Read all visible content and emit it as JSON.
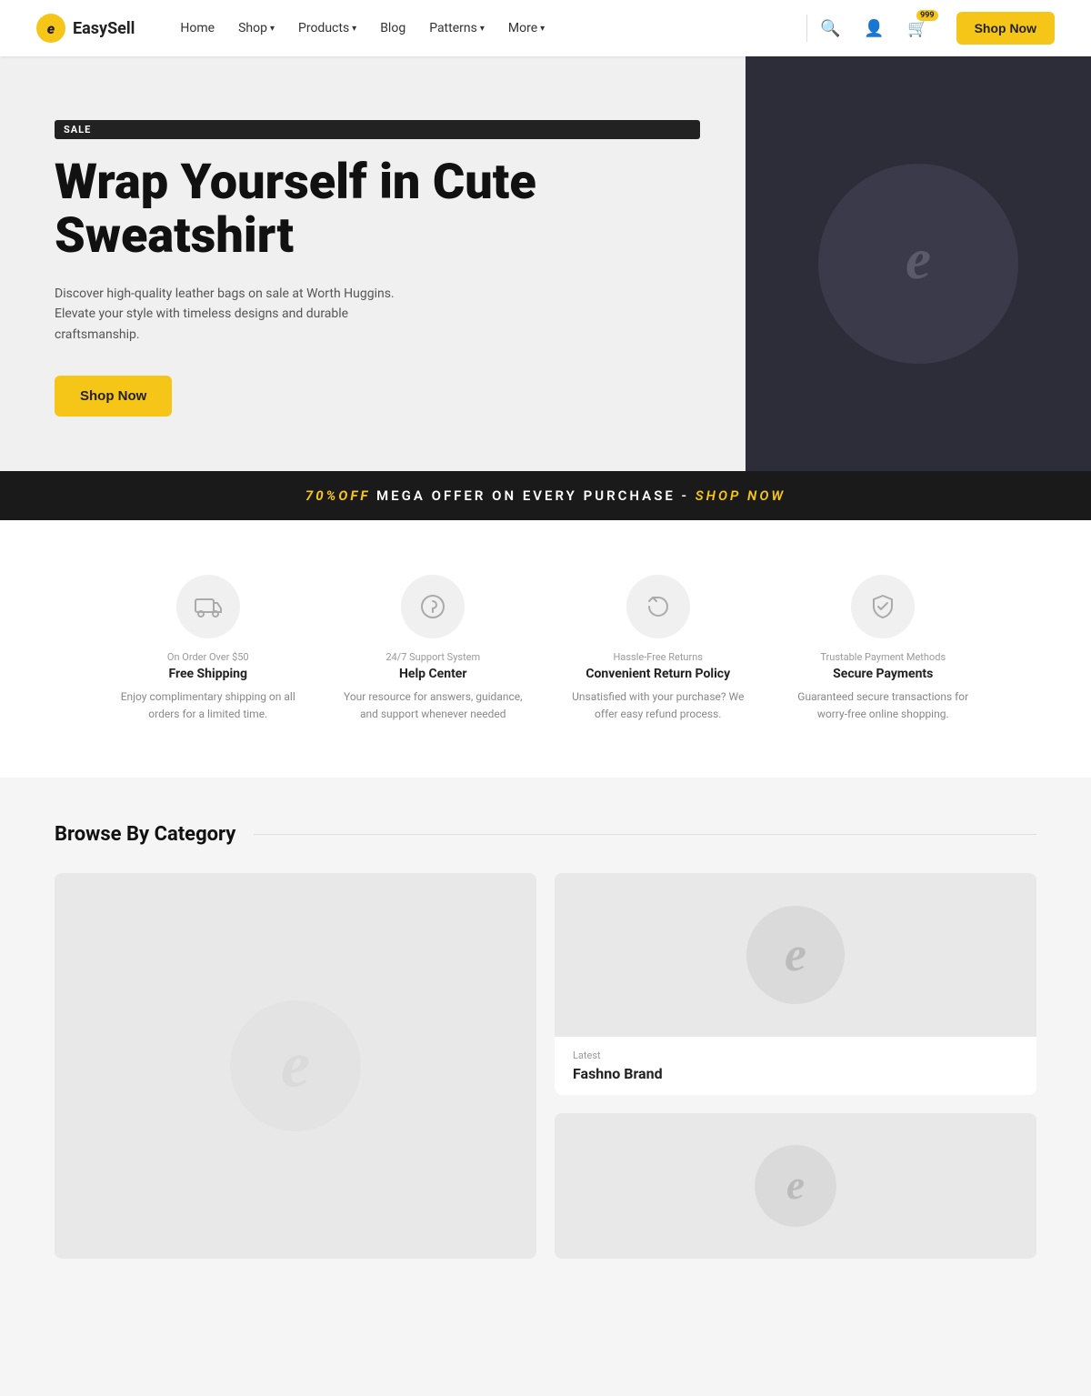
{
  "brand": {
    "name": "EasySell",
    "logo_letter": "e"
  },
  "nav": {
    "links": [
      {
        "label": "Home",
        "has_dropdown": false
      },
      {
        "label": "Shop",
        "has_dropdown": true
      },
      {
        "label": "Products",
        "has_dropdown": true
      },
      {
        "label": "Blog",
        "has_dropdown": false
      },
      {
        "label": "Patterns",
        "has_dropdown": true
      },
      {
        "label": "More",
        "has_dropdown": true
      }
    ],
    "shop_now_label": "Shop Now",
    "cart_count": "999"
  },
  "hero": {
    "sale_badge": "SALE",
    "title": "Wrap Yourself in Cute Sweatshirt",
    "description": "Discover high-quality leather bags on sale at Worth Huggins. Elevate your style with timeless designs and durable craftsmanship.",
    "cta_label": "Shop Now"
  },
  "promo_banner": {
    "discount": "70%OFF",
    "text": "MEGA OFFER ON EVERY PURCHASE -",
    "cta": "SHOP NOW"
  },
  "features": [
    {
      "subtitle": "On Order Over $50",
      "title": "Free Shipping",
      "description": "Enjoy complimentary shipping on all orders for a limited time.",
      "icon": "🚚"
    },
    {
      "subtitle": "24/7 Support System",
      "title": "Help Center",
      "description": "Your resource for answers, guidance, and support whenever needed",
      "icon": "🎧"
    },
    {
      "subtitle": "Hassle-Free Returns",
      "title": "Convenient Return Policy",
      "description": "Unsatisfied with your purchase? We offer easy refund process.",
      "icon": "↩"
    },
    {
      "subtitle": "Trustable Payment Methods",
      "title": "Secure Payments",
      "description": "Guaranteed secure transactions for worry-free online shopping.",
      "icon": "🔒"
    }
  ],
  "categories": {
    "section_title": "Browse By Category",
    "items": [
      {
        "tag": "",
        "name": ""
      },
      {
        "tag": "Latest",
        "name": "Fashno Brand"
      }
    ]
  }
}
